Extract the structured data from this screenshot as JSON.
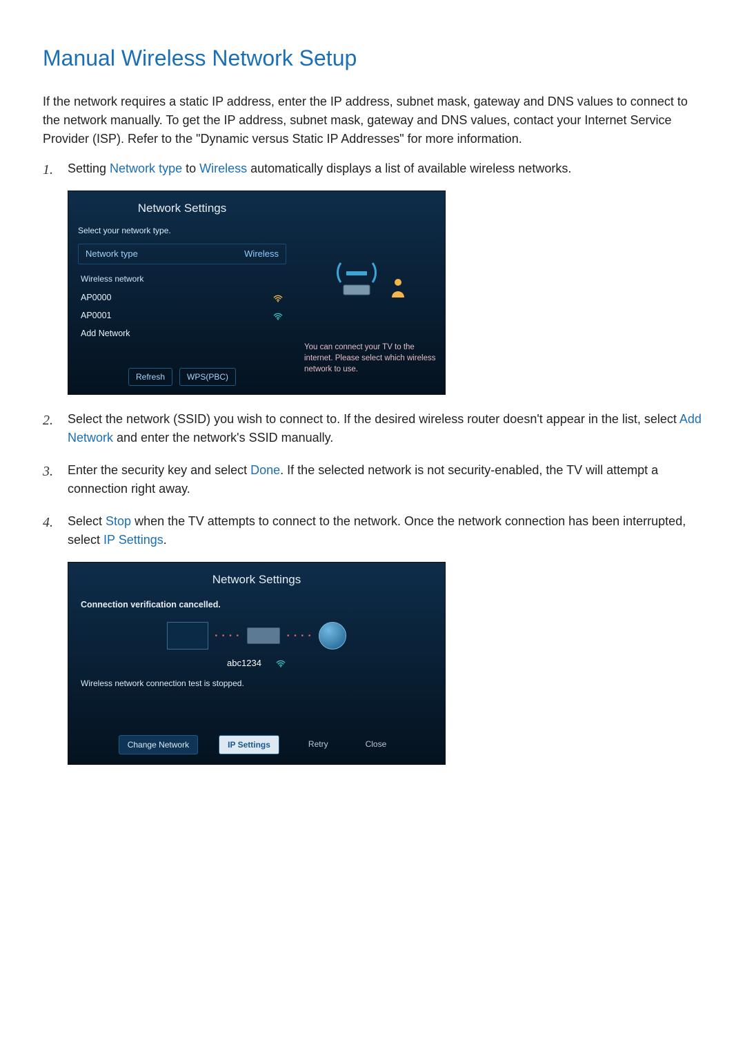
{
  "title": "Manual Wireless Network Setup",
  "intro": "If the network requires a static IP address, enter the IP address, subnet mask, gateway and DNS values to connect to the network manually. To get the IP address, subnet mask, gateway and DNS values, contact your Internet Service Provider (ISP). Refer to the \"Dynamic versus Static IP Addresses\" for more information.",
  "steps": {
    "s1_pre": "Setting ",
    "s1_kw1": "Network type",
    "s1_mid": " to ",
    "s1_kw2": "Wireless",
    "s1_post": " automatically displays a list of available wireless networks.",
    "s2_pre": "Select the network (SSID) you wish to connect to. If the desired wireless router doesn't appear in the list, select ",
    "s2_kw": "Add Network",
    "s2_post": " and enter the network's SSID manually.",
    "s3_pre": "Enter the security key and select ",
    "s3_kw": "Done",
    "s3_post": ". If the selected network is not security-enabled, the TV will attempt a connection right away.",
    "s4_pre": "Select ",
    "s4_kw1": "Stop",
    "s4_mid": " when the TV attempts to connect to the network. Once the network connection has been interrupted, select ",
    "s4_kw2": "IP Settings",
    "s4_post": "."
  },
  "panelA": {
    "title": "Network Settings",
    "subtitle": "Select your network type.",
    "nettype_label": "Network type",
    "nettype_value": "Wireless",
    "list_header": "Wireless network",
    "items": [
      {
        "ssid": "AP0000"
      },
      {
        "ssid": "AP0001"
      }
    ],
    "add_network": "Add Network",
    "refresh": "Refresh",
    "wps": "WPS(PBC)",
    "right_text": "You can connect your TV to the internet. Please select which wireless network to use."
  },
  "panelB": {
    "title": "Network Settings",
    "status": "Connection verification cancelled.",
    "ssid": "abc1234",
    "msg": "Wireless network connection test is stopped.",
    "buttons": {
      "change": "Change Network",
      "ip": "IP Settings",
      "retry": "Retry",
      "close": "Close"
    }
  }
}
